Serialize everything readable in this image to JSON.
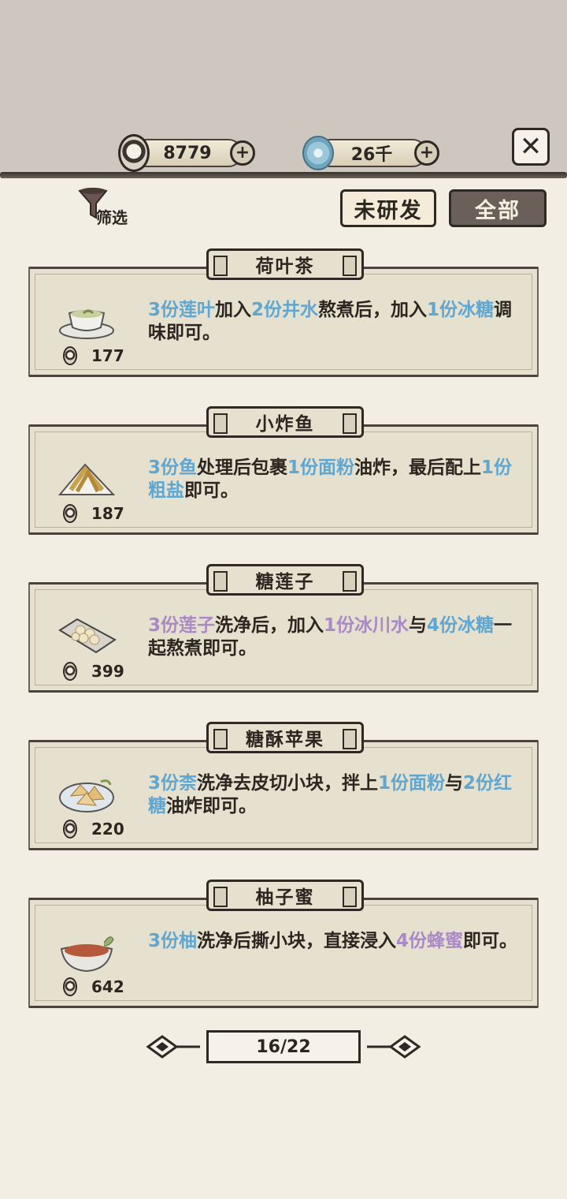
{
  "currency": {
    "coins": "8779",
    "jade": "26千"
  },
  "filter": {
    "label": "筛选"
  },
  "tabs": {
    "unresearched": "未研发",
    "all": "全部",
    "selected": "all"
  },
  "recipes": [
    {
      "name": "荷叶茶",
      "price": "177",
      "icon": "lotus-tea-icon",
      "desc": [
        {
          "t": "3份莲叶",
          "c": "b"
        },
        {
          "t": "加入",
          "c": ""
        },
        {
          "t": "2份井水",
          "c": "b"
        },
        {
          "t": "熬煮后，加入",
          "c": ""
        },
        {
          "t": "1份冰糖",
          "c": "b"
        },
        {
          "t": "调味即可。",
          "c": ""
        }
      ]
    },
    {
      "name": "小炸鱼",
      "price": "187",
      "icon": "fried-fish-icon",
      "desc": [
        {
          "t": "3份鱼",
          "c": "b"
        },
        {
          "t": "处理后包裹",
          "c": ""
        },
        {
          "t": "1份面粉",
          "c": "b"
        },
        {
          "t": "油炸，最后配上",
          "c": ""
        },
        {
          "t": "1份粗盐",
          "c": "b"
        },
        {
          "t": "即可。",
          "c": ""
        }
      ]
    },
    {
      "name": "糖莲子",
      "price": "399",
      "icon": "candied-lotus-seed-icon",
      "desc": [
        {
          "t": "3份莲子",
          "c": "p"
        },
        {
          "t": "洗净后，加入",
          "c": ""
        },
        {
          "t": "1份冰川水",
          "c": "p"
        },
        {
          "t": "与",
          "c": ""
        },
        {
          "t": "4份冰糖",
          "c": "b"
        },
        {
          "t": "一起熬煮即可。",
          "c": ""
        }
      ]
    },
    {
      "name": "糖酥苹果",
      "price": "220",
      "icon": "crispy-apple-icon",
      "desc": [
        {
          "t": "3份柰",
          "c": "b"
        },
        {
          "t": "洗净去皮切小块，拌上",
          "c": ""
        },
        {
          "t": "1份面粉",
          "c": "b"
        },
        {
          "t": "与",
          "c": ""
        },
        {
          "t": "2份红糖",
          "c": "b"
        },
        {
          "t": "油炸即可。",
          "c": ""
        }
      ]
    },
    {
      "name": "柚子蜜",
      "price": "642",
      "icon": "pomelo-honey-icon",
      "desc": [
        {
          "t": "3份柚",
          "c": "b"
        },
        {
          "t": "洗净后撕小块，直接浸入",
          "c": ""
        },
        {
          "t": "4份蜂蜜",
          "c": "p"
        },
        {
          "t": "即可。",
          "c": ""
        }
      ]
    }
  ],
  "pager": {
    "label": "16/22"
  },
  "colors": {
    "highlight_blue": "#5fa7d3",
    "highlight_purple": "#a98ac6",
    "ink": "#2b2620",
    "paper": "#e6e0cf"
  }
}
